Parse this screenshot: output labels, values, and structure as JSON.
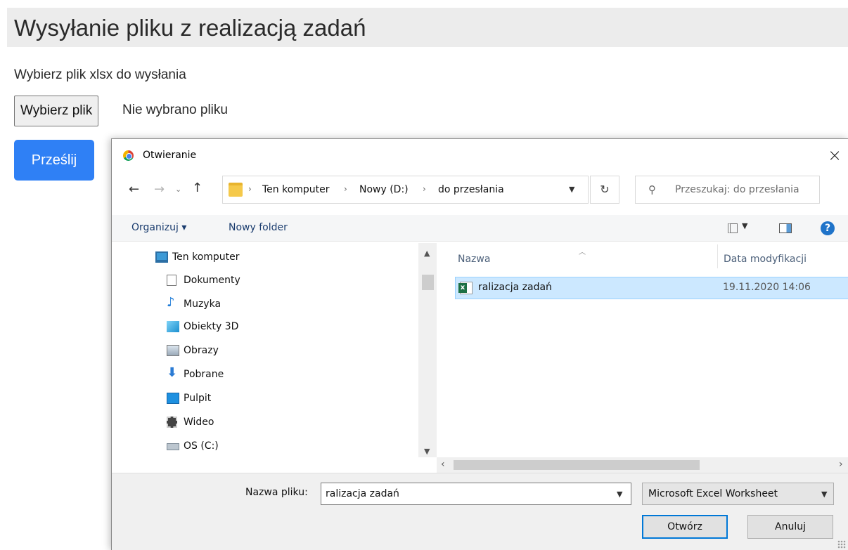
{
  "page": {
    "title": "Wysyłanie pliku z realizacją zadań",
    "instruction": "Wybierz plik xlsx do wysłania",
    "file_button": "Wybierz plik",
    "file_status": "Nie wybrano pliku",
    "submit": "Prześlij",
    "accent": "#2f80f5"
  },
  "dialog": {
    "title": "Otwieranie",
    "close": "×",
    "address": {
      "crumbs": [
        "Ten komputer",
        "Nowy (D:)",
        "do przesłania"
      ],
      "search_placeholder": "Przeszukaj: do przesłania"
    },
    "toolbar": {
      "organize": "Organizuj ▾",
      "new_folder": "Nowy folder",
      "help": "?"
    },
    "tree": [
      {
        "label": "Ten komputer",
        "icon": "computer-icon"
      },
      {
        "label": "Dokumenty",
        "icon": "documents-icon"
      },
      {
        "label": "Muzyka",
        "icon": "music-icon"
      },
      {
        "label": "Obiekty 3D",
        "icon": "objects-3d-icon"
      },
      {
        "label": "Obrazy",
        "icon": "pictures-icon"
      },
      {
        "label": "Pobrane",
        "icon": "downloads-icon"
      },
      {
        "label": "Pulpit",
        "icon": "desktop-icon"
      },
      {
        "label": "Wideo",
        "icon": "video-icon"
      },
      {
        "label": "OS (C:)",
        "icon": "drive-icon"
      }
    ],
    "columns": {
      "name": "Nazwa",
      "modified": "Data modyfikacji"
    },
    "files": [
      {
        "name": "ralizacja zadań",
        "modified": "19.11.2020 14:06",
        "icon": "excel-file-icon"
      }
    ],
    "bottom": {
      "filename_label": "Nazwa pliku:",
      "filename_value": "ralizacja zadań",
      "file_type": "Microsoft Excel Worksheet",
      "open": "Otwórz",
      "cancel": "Anuluj"
    }
  }
}
